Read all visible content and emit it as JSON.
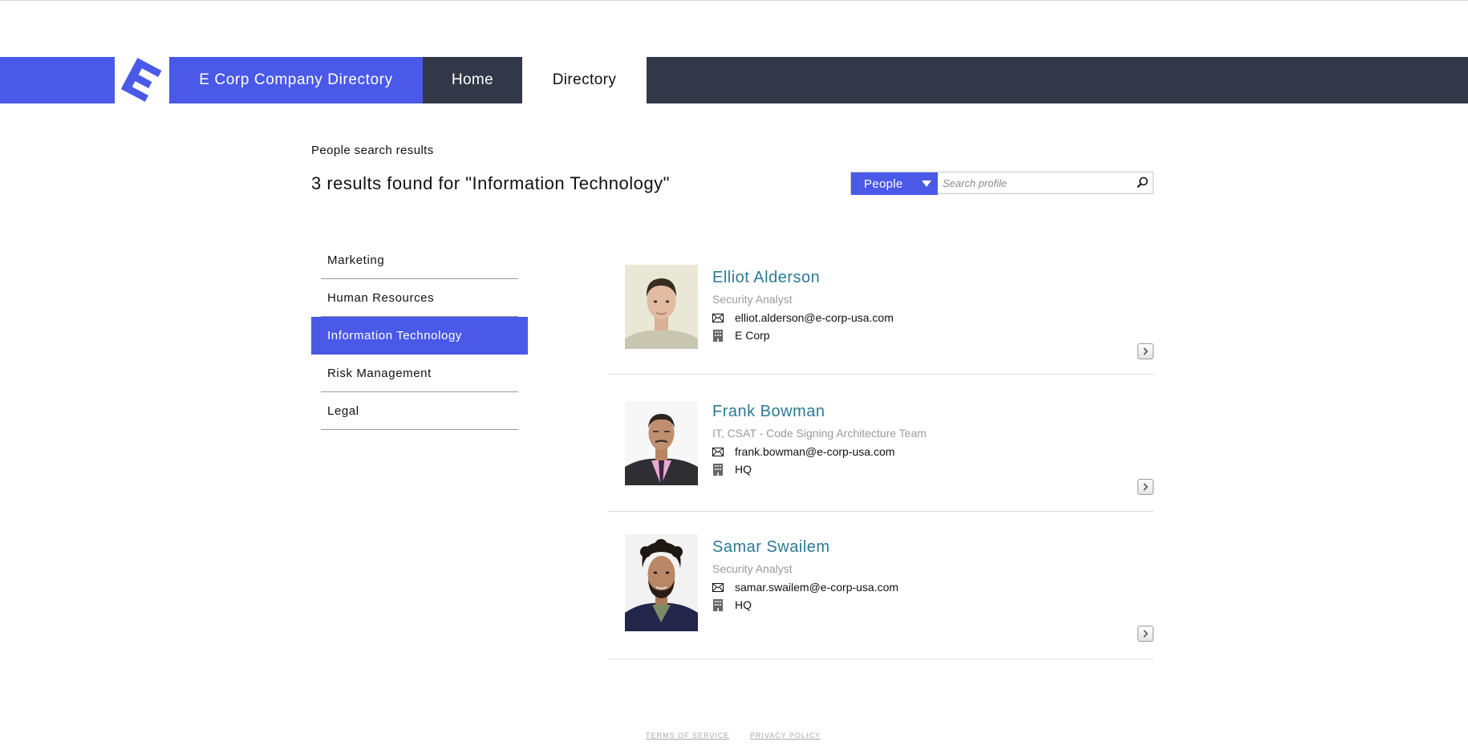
{
  "nav": {
    "brand": "E Corp Company Directory",
    "home": "Home",
    "directory": "Directory",
    "logo_letter": "E",
    "accent_color": "#4a59e8",
    "dark_color": "#323847"
  },
  "header": {
    "subtitle": "People search results",
    "results_title": "3 results found for \"Information Technology\""
  },
  "search": {
    "type_selected": "People",
    "placeholder": "Search profile",
    "value": "",
    "button_icon": "search-icon"
  },
  "sidebar": {
    "items": [
      {
        "label": "Marketing",
        "active": false
      },
      {
        "label": "Human Resources",
        "active": false
      },
      {
        "label": "Information Technology",
        "active": true
      },
      {
        "label": "Risk Management",
        "active": false
      },
      {
        "label": "Legal",
        "active": false
      }
    ]
  },
  "results": [
    {
      "name": "Elliot Alderson",
      "role": "Security Analyst",
      "email": "elliot.alderson@e-corp-usa.com",
      "location": "E Corp"
    },
    {
      "name": "Frank Bowman",
      "role": "IT, CSAT - Code Signing Architecture Team",
      "email": "frank.bowman@e-corp-usa.com",
      "location": "HQ"
    },
    {
      "name": "Samar Swailem",
      "role": "Security Analyst",
      "email": "samar.swailem@e-corp-usa.com",
      "location": "HQ"
    }
  ],
  "footer": {
    "terms": "TERMS OF SERVICE",
    "privacy": "PRIVACY POLICY"
  }
}
